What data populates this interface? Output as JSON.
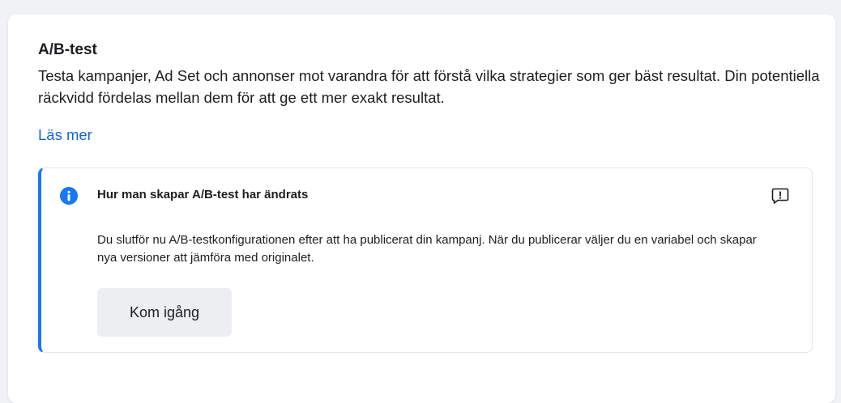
{
  "section": {
    "title": "A/B-test",
    "description": "Testa kampanjer, Ad Set och annonser mot varandra för att förstå vilka strategier som ger bäst resultat. Din potentiella räckvidd fördelas mellan dem för att ge ett mer exakt resultat.",
    "learn_more_label": "Läs mer"
  },
  "notice": {
    "title": "Hur man skapar A/B-test har ändrats",
    "body": "Du slutför nu A/B-testkonfigurationen efter att ha publicerat din kampanj. När du publicerar väljer du en variabel och skapar nya versioner att jämföra med originalet.",
    "button_label": "Kom igång",
    "icons": {
      "info": "info-icon",
      "report": "report-feedback-icon"
    }
  },
  "colors": {
    "accent": "#1877f2",
    "link": "#1664d9",
    "text": "#1c1e21",
    "button_bg": "#eceef1",
    "page_bg": "#f0f2f5"
  }
}
